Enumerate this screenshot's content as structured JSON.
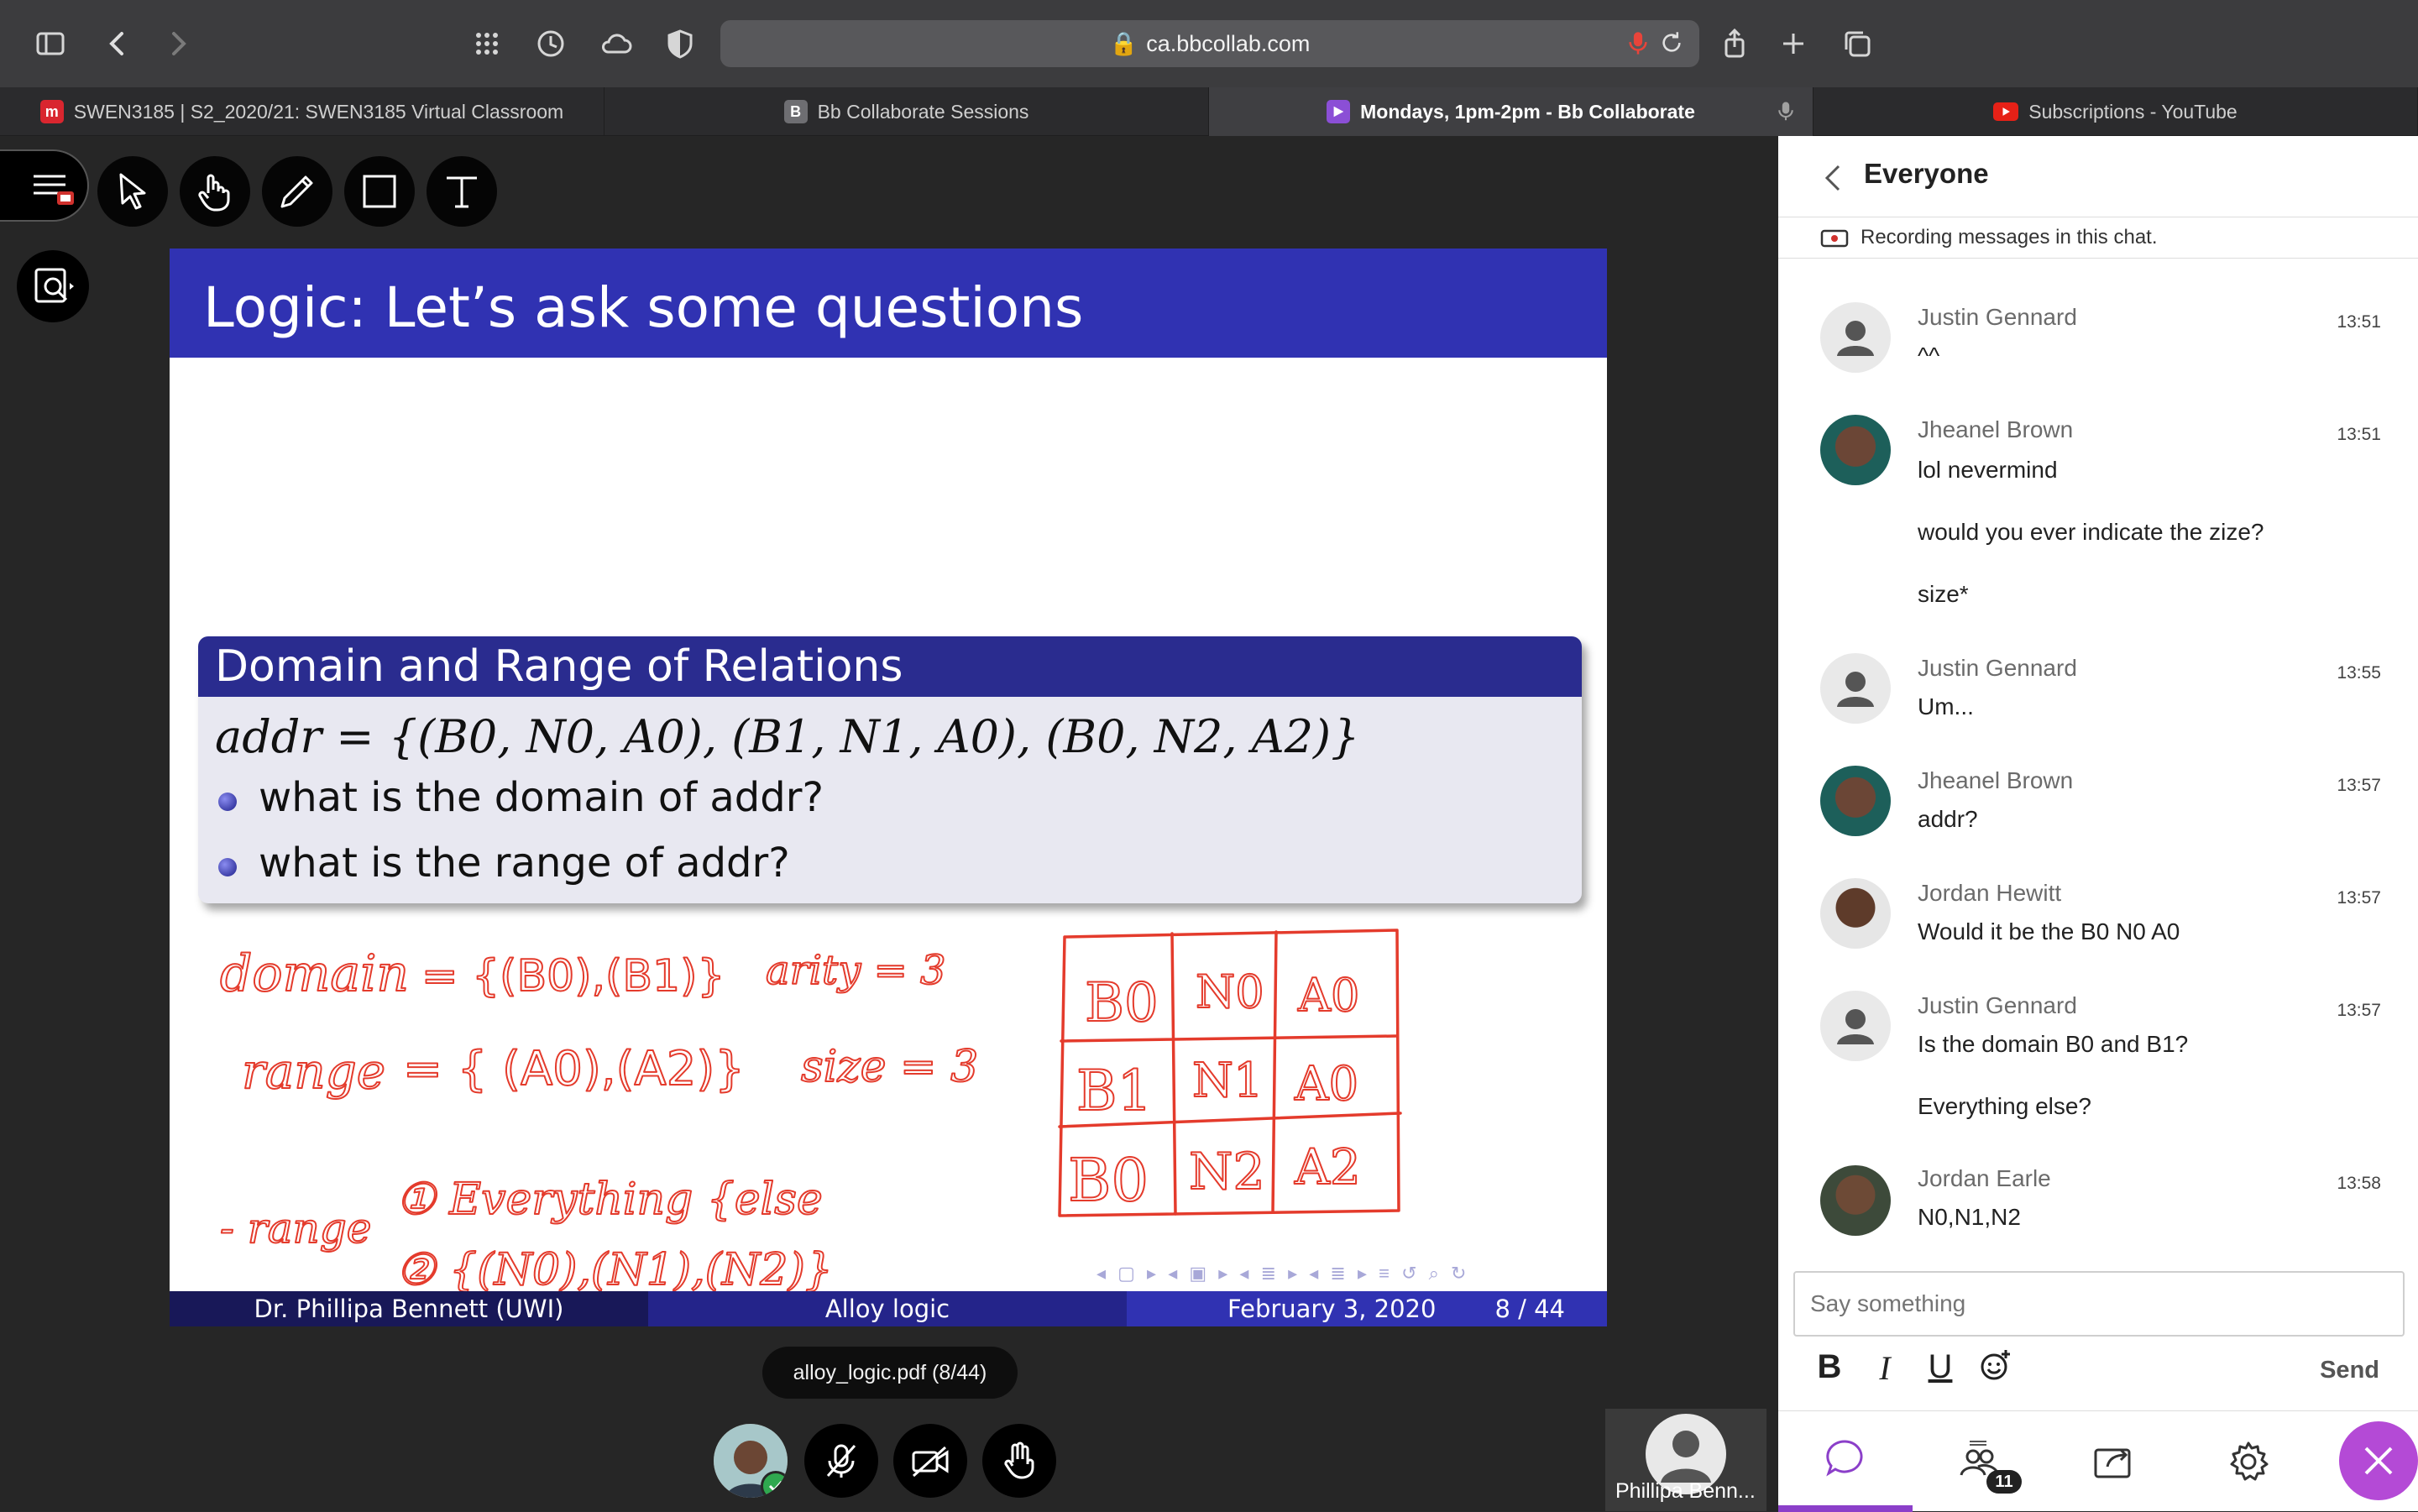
{
  "browser": {
    "url": "ca.bbcollab.com",
    "tabs": [
      {
        "label": "SWEN3185 | S2_2020/21: SWEN3185 Virtual Classroom",
        "fav": "m",
        "fav_color": "#d9262f"
      },
      {
        "label": "Bb Collaborate Sessions",
        "fav": "B",
        "fav_color": "#6e6e72"
      },
      {
        "label": "Mondays, 1pm-2pm - Bb Collaborate",
        "fav": "",
        "fav_color": "#8b4fd6"
      },
      {
        "label": "Subscriptions - YouTube",
        "fav": "",
        "fav_color": "#e62117"
      }
    ]
  },
  "slide": {
    "title": "Logic:  Let’s ask some questions",
    "block_title": "Domain and Range of Relations",
    "formula": "addr = {(B0, N0, A0), (B1, N1, A0), (B0, N2, A2)}",
    "bullets": [
      "what is the domain of addr?",
      "what is the range of addr?"
    ],
    "footer": {
      "author": "Dr. Phillipa Bennett  (UWI)",
      "topic": "Alloy logic",
      "date": "February 3, 2020",
      "page": "8 / 44"
    },
    "nav_symbols": "◂ ▢ ▸ ◂ ▣ ▸ ◂ ≣ ▸ ◂ ≣ ▸   ≡   ↺ ⌕ ↻",
    "colors": {
      "header": "#3032b2",
      "ink": "#e43b2c"
    }
  },
  "file_chip": "alloy_logic.pdf   (8/44)",
  "presenter": {
    "name": "Phillipa Benn..."
  },
  "chat": {
    "title": "Everyone",
    "recording_note": "Recording messages in this chat.",
    "messages": [
      {
        "author": "Justin Gennard",
        "time": "13:51",
        "lines": [
          "^^"
        ]
      },
      {
        "author": "Jheanel Brown",
        "time": "13:51",
        "lines": [
          "lol nevermind",
          "would you ever indicate the zize?",
          "size*"
        ]
      },
      {
        "author": "Justin Gennard",
        "time": "13:55",
        "lines": [
          "Um..."
        ]
      },
      {
        "author": "Jheanel Brown",
        "time": "13:57",
        "lines": [
          "addr?"
        ]
      },
      {
        "author": "Jordan Hewitt",
        "time": "13:57",
        "lines": [
          "Would it be the B0 N0 A0"
        ]
      },
      {
        "author": "Justin Gennard",
        "time": "13:57",
        "lines": [
          "Is the domain B0 and B1?",
          "Everything else?"
        ]
      },
      {
        "author": "Jordan Earle",
        "time": "13:58",
        "lines": [
          "N0,N1,N2"
        ]
      }
    ],
    "input_placeholder": "Say something",
    "format_bold": "B",
    "format_italic": "I",
    "format_underline": "U",
    "send_label": "Send",
    "participants_count": "11"
  }
}
